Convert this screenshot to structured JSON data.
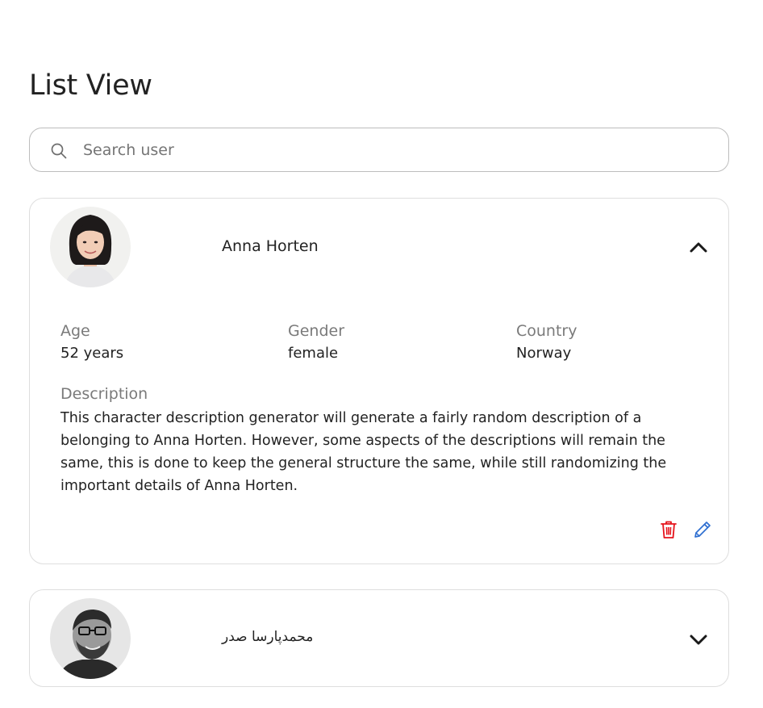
{
  "page": {
    "title": "List View"
  },
  "search": {
    "placeholder": "Search user",
    "value": ""
  },
  "users": [
    {
      "name": "Anna Horten",
      "expanded": true,
      "details": {
        "age_label": "Age",
        "age_value": "52 years",
        "gender_label": "Gender",
        "gender_value": "female",
        "country_label": "Country",
        "country_value": "Norway",
        "description_label": "Description",
        "description_value": "This character description generator will generate a fairly random description of a belonging to Anna Horten. However, some aspects of the descriptions will remain the same, this is done to keep the general structure the same, while still randomizing the important details of Anna Horten."
      },
      "actions": {
        "delete_icon": "trash-icon",
        "edit_icon": "pencil-icon"
      },
      "toggle_icon": "chevron-up-icon"
    },
    {
      "name": "محمدپارسا صدر",
      "expanded": false,
      "toggle_icon": "chevron-down-icon"
    }
  ],
  "colors": {
    "delete": "#e5141c",
    "edit": "#2f6fd1",
    "border": "#dedede",
    "label": "#7a7a7a",
    "text": "#222222"
  }
}
